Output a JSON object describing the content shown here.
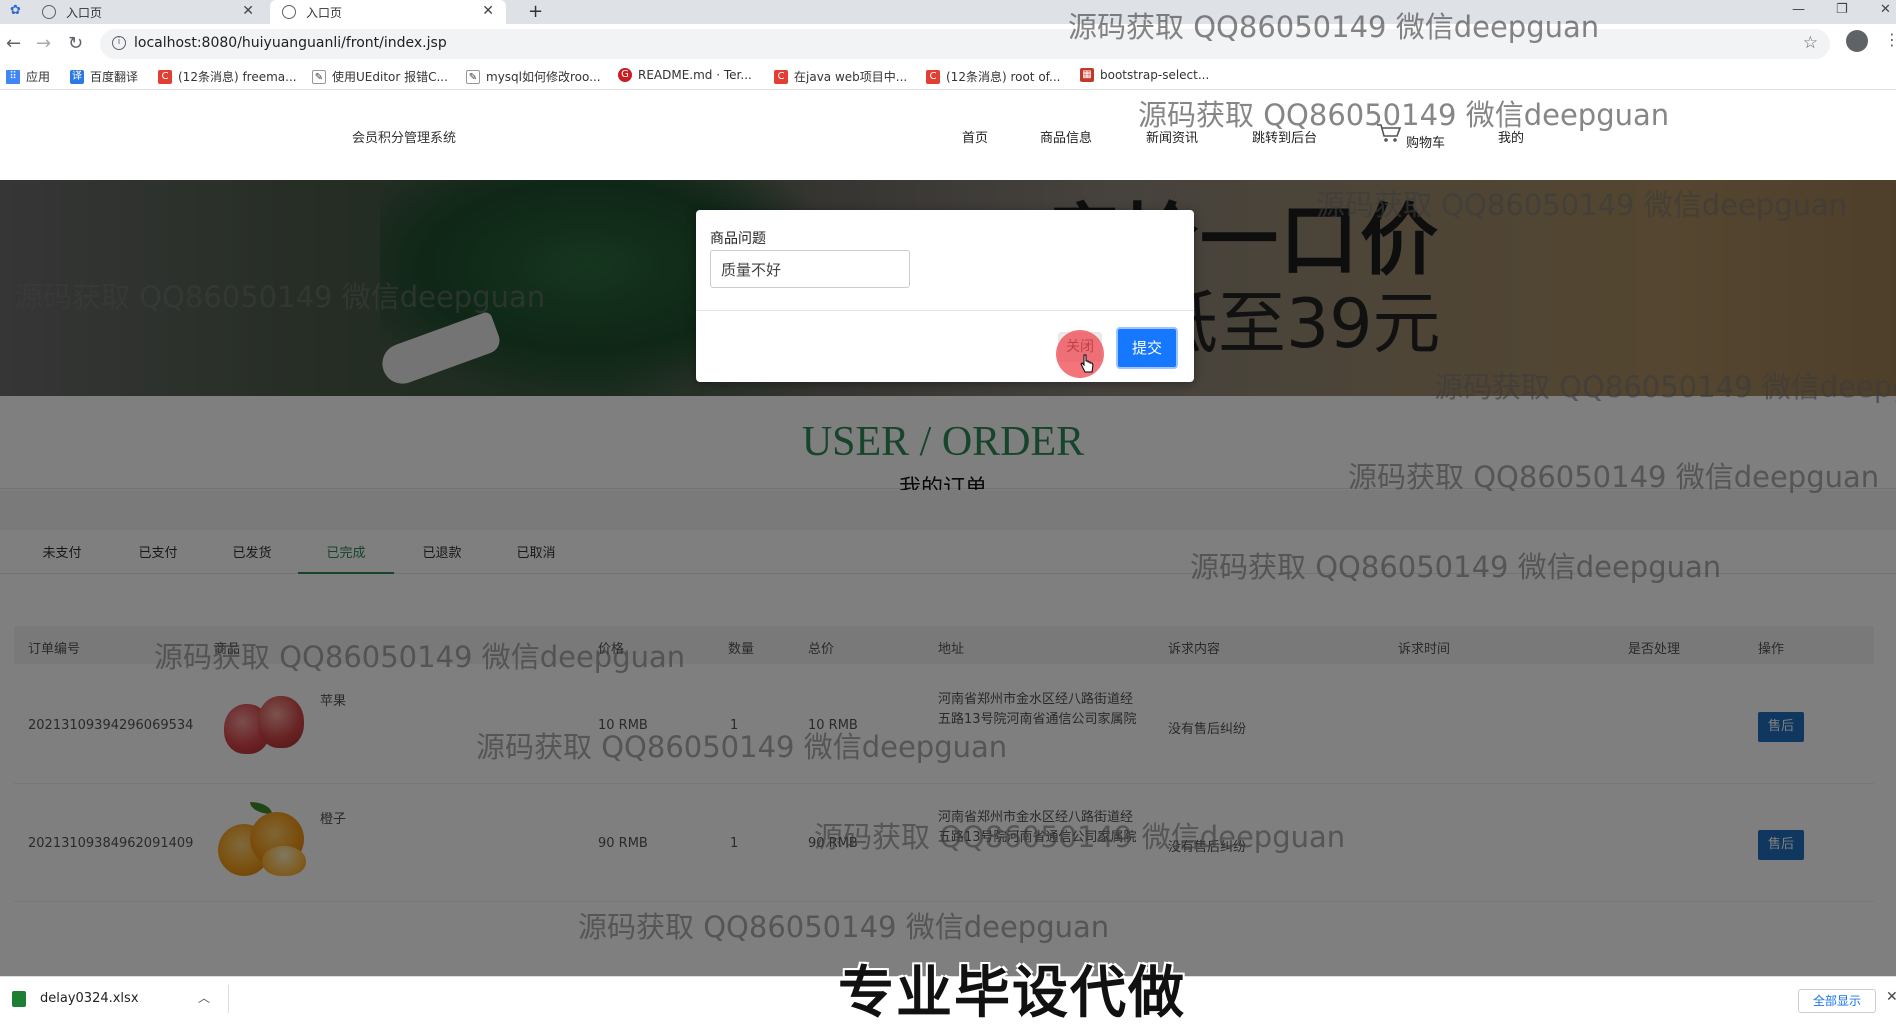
{
  "browser": {
    "tabs": [
      {
        "title": "入口页",
        "active": false
      },
      {
        "title": "入口页",
        "active": true
      }
    ],
    "url": "localhost:8080/huiyuanguanli/front/index.jsp",
    "bookmarks": [
      {
        "label": "应用",
        "icon": "apps-icon"
      },
      {
        "label": "百度翻译",
        "icon": "baidu-translate-icon"
      },
      {
        "label": "(12条消息) freema...",
        "icon": "csdn-icon"
      },
      {
        "label": "使用UEditor 报错C...",
        "icon": "page-icon"
      },
      {
        "label": "mysql如何修改roo...",
        "icon": "page-icon"
      },
      {
        "label": "README.md · Ter...",
        "icon": "gitee-icon"
      },
      {
        "label": "在java web项目中...",
        "icon": "csdn-icon"
      },
      {
        "label": "(12条消息) root of...",
        "icon": "csdn-icon"
      },
      {
        "label": "bootstrap-select...",
        "icon": "site-icon"
      }
    ]
  },
  "site": {
    "name": "会员积分管理系统",
    "nav": [
      "首页",
      "商品信息",
      "新闻资讯",
      "跳转到后台",
      "购物车",
      "我的"
    ]
  },
  "banner": {
    "headline": "疯抢一口价",
    "price": "低至39元"
  },
  "section": {
    "en_title": "USER / ORDER",
    "cn_title": "我的订单"
  },
  "order_tabs": [
    {
      "label": "未支付",
      "active": false
    },
    {
      "label": "已支付",
      "active": false
    },
    {
      "label": "已发货",
      "active": false
    },
    {
      "label": "已完成",
      "active": true
    },
    {
      "label": "已退款",
      "active": false
    },
    {
      "label": "已取消",
      "active": false
    }
  ],
  "table": {
    "headers": [
      "订单编号",
      "商品",
      "价格",
      "数量",
      "总价",
      "地址",
      "诉求内容",
      "诉求时间",
      "是否处理",
      "操作"
    ],
    "rows": [
      {
        "order_no": "20213109394296069534",
        "product": "苹果",
        "image": "apple",
        "price": "10 RMB",
        "qty": "1",
        "total": "10 RMB",
        "address": "河南省郑州市金水区经八路街道经五路13号院河南省通信公司家属院",
        "appeal": "没有售后纠纷",
        "appeal_time": "",
        "handled": "",
        "action": "售后"
      },
      {
        "order_no": "20213109384962091409",
        "product": "橙子",
        "image": "orange",
        "price": "90 RMB",
        "qty": "1",
        "total": "90 RMB",
        "address": "河南省郑州市金水区经八路街道经五路13号院河南省通信公司家属院",
        "appeal": "没有售后纠纷",
        "appeal_time": "",
        "handled": "",
        "action": "售后"
      }
    ]
  },
  "modal": {
    "label": "商品问题",
    "input_value": "质量不好",
    "close_label": "关闭",
    "submit_label": "提交"
  },
  "download": {
    "filename": "delay0324.xlsx",
    "show_all": "全部显示"
  },
  "overlay_caption": "专业毕设代做",
  "watermark": "源码获取 QQ86050149 微信deepguan",
  "colors": {
    "accent_green": "#2e8b57",
    "button_blue": "#1e6fbf",
    "submit_blue": "#1677ff"
  }
}
